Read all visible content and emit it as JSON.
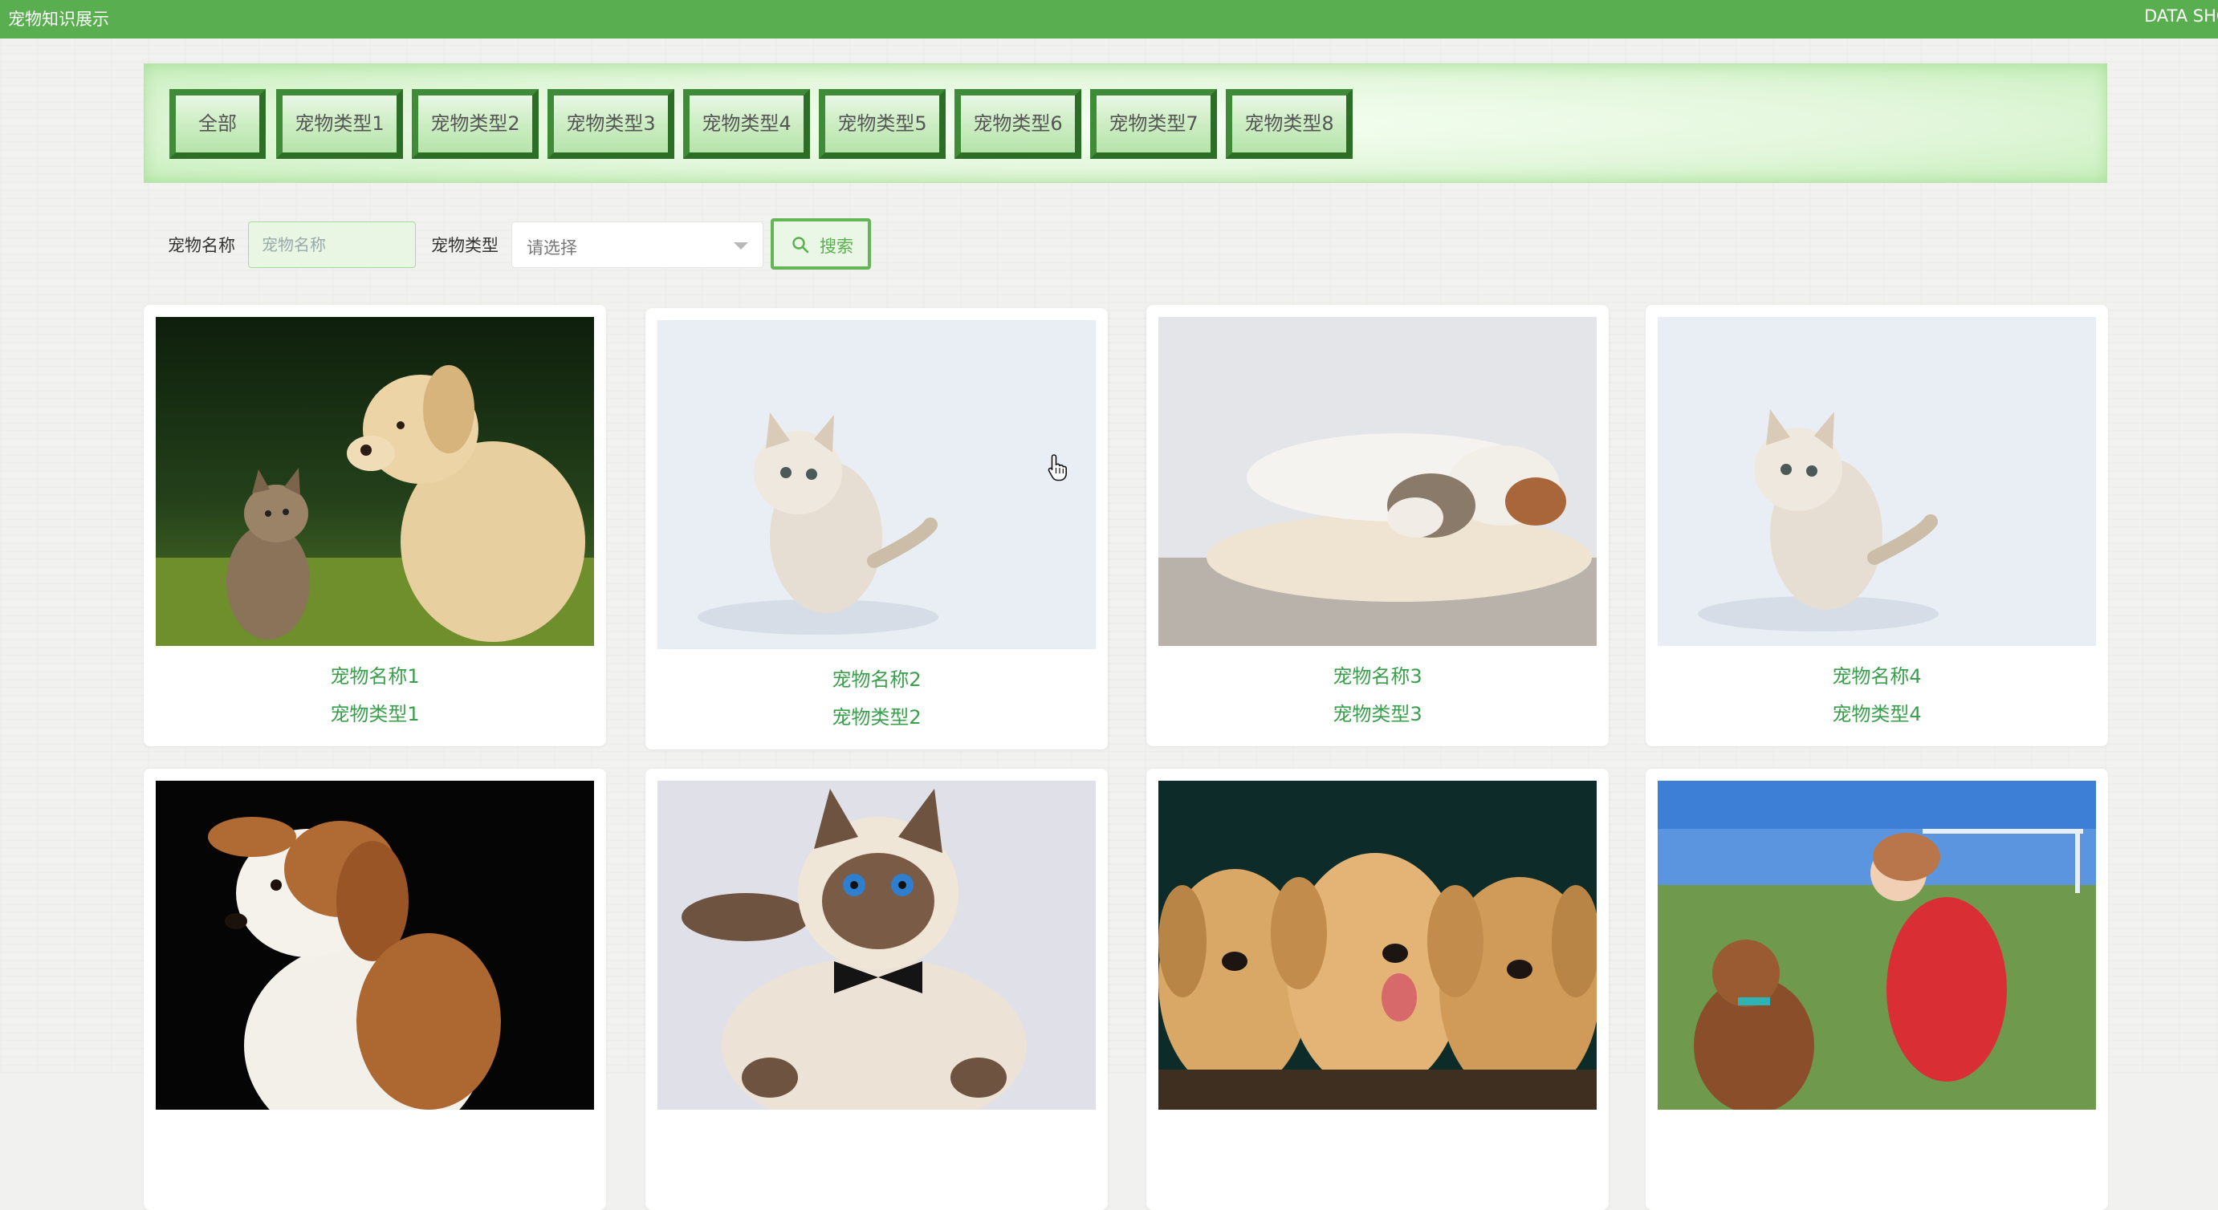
{
  "header": {
    "title": "宠物知识展示",
    "right_text": "DATA SHOW"
  },
  "categories": [
    "全部",
    "宠物类型1",
    "宠物类型2",
    "宠物类型3",
    "宠物类型4",
    "宠物类型5",
    "宠物类型6",
    "宠物类型7",
    "宠物类型8"
  ],
  "search": {
    "name_label": "宠物名称",
    "name_placeholder": "宠物名称",
    "type_label": "宠物类型",
    "type_placeholder": "请选择",
    "button_label": "搜索"
  },
  "pets": [
    {
      "name": "宠物名称1",
      "type": "宠物类型1",
      "image": "puppy-and-kitten"
    },
    {
      "name": "宠物名称2",
      "type": "宠物类型2",
      "image": "white-kitten"
    },
    {
      "name": "宠物名称3",
      "type": "宠物类型3",
      "image": "cat-and-dog-sleeping"
    },
    {
      "name": "宠物名称4",
      "type": "宠物类型4",
      "image": "white-kitten"
    },
    {
      "name": "",
      "type": "",
      "image": "beagle-puppy"
    },
    {
      "name": "",
      "type": "",
      "image": "siamese-cat-bowtie"
    },
    {
      "name": "",
      "type": "",
      "image": "golden-retriever-puppies"
    },
    {
      "name": "",
      "type": "",
      "image": "woman-with-poodle"
    }
  ],
  "colors": {
    "primary": "#59ae4f",
    "text_green": "#3a9e4c"
  }
}
